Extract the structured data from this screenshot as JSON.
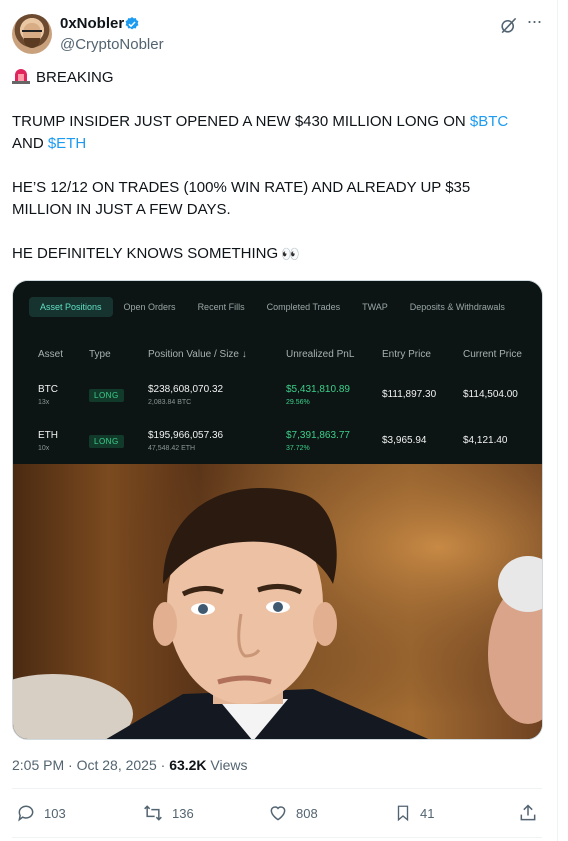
{
  "author": {
    "display_name": "0xNobler",
    "handle": "@CryptoNobler"
  },
  "tweet": {
    "line1": "BREAKING",
    "line2_a": "TRUMP INSIDER JUST OPENED A NEW $430 MILLION LONG ON ",
    "line2_link1": "$BTC",
    "line2_b": "AND ",
    "line2_link2": "$ETH",
    "line3": "HE’S 12/12 ON TRADES (100% WIN RATE) AND ALREADY UP $35 MILLION IN JUST A FEW DAYS.",
    "line4": "HE DEFINITELY KNOWS SOMETHING",
    "line4_emoji": "👀"
  },
  "panel": {
    "tabs": [
      "Asset Positions",
      "Open Orders",
      "Recent Fills",
      "Completed Trades",
      "TWAP",
      "Deposits & Withdrawals"
    ],
    "headers": {
      "asset": "Asset",
      "type": "Type",
      "position": "Position Value / Size ↓",
      "pnl": "Unrealized PnL",
      "entry": "Entry Price",
      "current": "Current Price"
    },
    "rows": [
      {
        "asset": "BTC",
        "leverage": "13x",
        "type": "LONG",
        "value": "$238,608,070.32",
        "size": "2,083.84 BTC",
        "pnl": "$5,431,810.89",
        "pnl_pct": "29.56%",
        "entry": "$111,897.30",
        "current": "$114,504.00"
      },
      {
        "asset": "ETH",
        "leverage": "10x",
        "type": "LONG",
        "value": "$195,966,057.36",
        "size": "47,548.42 ETH",
        "pnl": "$7,391,863.77",
        "pnl_pct": "37.72%",
        "entry": "$3,965.94",
        "current": "$4,121.40"
      }
    ]
  },
  "meta": {
    "time": "2:05 PM · Oct 28, 2025 · ",
    "views_count": "63.2K",
    "views_label": " Views"
  },
  "actions": {
    "replies": "103",
    "reposts": "136",
    "likes": "808",
    "bookmarks": "41"
  },
  "colors": {
    "link": "#1d9bf0",
    "verified": "#1d9bf0",
    "pnl_green": "#3ccf8a",
    "active_tab": "#5fe0c3"
  }
}
